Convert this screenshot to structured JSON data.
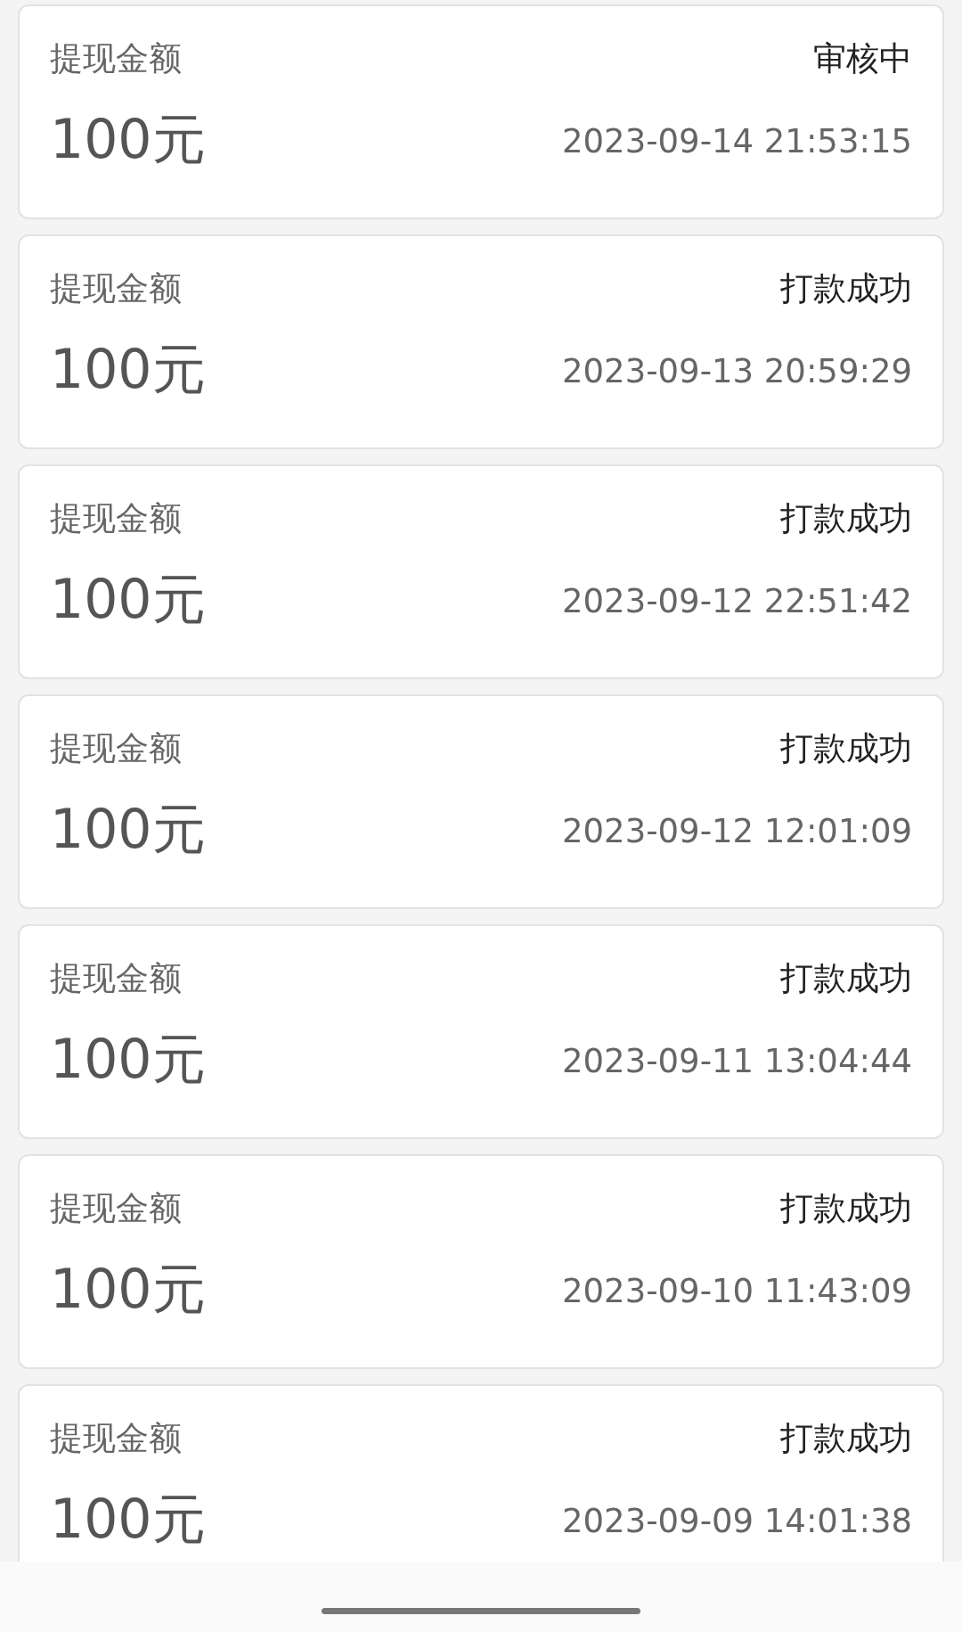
{
  "records": [
    {
      "label": "提现金额",
      "amount": "100元",
      "status": "审核中",
      "time": "2023-09-14 21:53:15"
    },
    {
      "label": "提现金额",
      "amount": "100元",
      "status": "打款成功",
      "time": "2023-09-13 20:59:29"
    },
    {
      "label": "提现金额",
      "amount": "100元",
      "status": "打款成功",
      "time": "2023-09-12 22:51:42"
    },
    {
      "label": "提现金额",
      "amount": "100元",
      "status": "打款成功",
      "time": "2023-09-12 12:01:09"
    },
    {
      "label": "提现金额",
      "amount": "100元",
      "status": "打款成功",
      "time": "2023-09-11 13:04:44"
    },
    {
      "label": "提现金额",
      "amount": "100元",
      "status": "打款成功",
      "time": "2023-09-10 11:43:09"
    },
    {
      "label": "提现金额",
      "amount": "100元",
      "status": "打款成功",
      "time": "2023-09-09 14:01:38"
    }
  ]
}
